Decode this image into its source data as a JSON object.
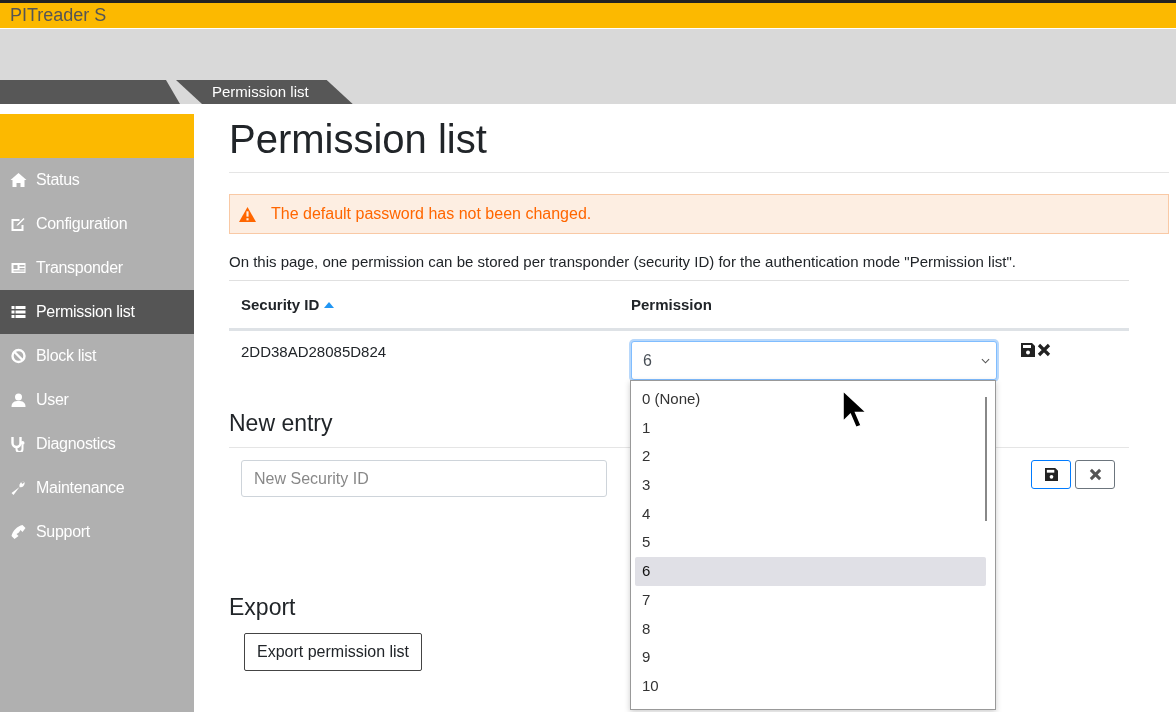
{
  "app": {
    "title": "PITreader S"
  },
  "breadcrumb": {
    "current": "Permission list"
  },
  "sidebar": {
    "items": [
      {
        "label": "Status",
        "selected": false
      },
      {
        "label": "Configuration",
        "selected": false
      },
      {
        "label": "Transponder",
        "selected": false
      },
      {
        "label": "Permission list",
        "selected": true
      },
      {
        "label": "Block list",
        "selected": false
      },
      {
        "label": "User",
        "selected": false
      },
      {
        "label": "Diagnostics",
        "selected": false
      },
      {
        "label": "Maintenance",
        "selected": false
      },
      {
        "label": "Support",
        "selected": false
      }
    ]
  },
  "page": {
    "title": "Permission list",
    "alert": "The default password has not been changed.",
    "description": "On this page, one permission can be stored per transponder (security ID) for the authentication mode \"Permission list\".",
    "table": {
      "columns": [
        {
          "label": "Security ID",
          "sorted": true
        },
        {
          "label": "Permission",
          "sorted": false
        }
      ],
      "rows": [
        {
          "security_id": "2DD38AD28085D824",
          "permission": "6",
          "dropdown_open": true
        }
      ]
    },
    "dropdown_options": [
      {
        "label": "0 (None)",
        "selected": false
      },
      {
        "label": "1",
        "selected": false
      },
      {
        "label": "2",
        "selected": false
      },
      {
        "label": "3",
        "selected": false
      },
      {
        "label": "4",
        "selected": false
      },
      {
        "label": "5",
        "selected": false
      },
      {
        "label": "6",
        "selected": true
      },
      {
        "label": "7",
        "selected": false
      },
      {
        "label": "8",
        "selected": false
      },
      {
        "label": "9",
        "selected": false
      },
      {
        "label": "10",
        "selected": false
      }
    ],
    "new_entry": {
      "heading": "New entry",
      "placeholder": "New Security ID"
    },
    "export": {
      "heading": "Export",
      "button": "Export permission list"
    }
  }
}
